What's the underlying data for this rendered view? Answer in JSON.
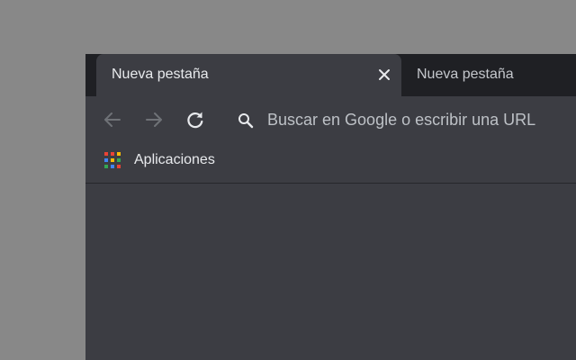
{
  "tabs": [
    {
      "title": "Nueva pestaña",
      "active": true
    },
    {
      "title": "Nueva pestaña",
      "active": false
    }
  ],
  "toolbar": {
    "back_icon": "arrow-left-icon",
    "forward_icon": "arrow-right-icon",
    "reload_icon": "reload-icon",
    "search_icon": "search-icon",
    "omnibox_placeholder": "Buscar en Google o escribir una URL"
  },
  "bookmarks": {
    "apps_icon": "apps-grid-icon",
    "apps_label": "Aplicaciones"
  },
  "colors": {
    "desktop_bg": "#888888",
    "tabstrip_bg": "#1f2024",
    "toolbar_bg": "#3c3d43",
    "text_primary": "#e8eaed",
    "icon_disabled": "#6f7277"
  }
}
